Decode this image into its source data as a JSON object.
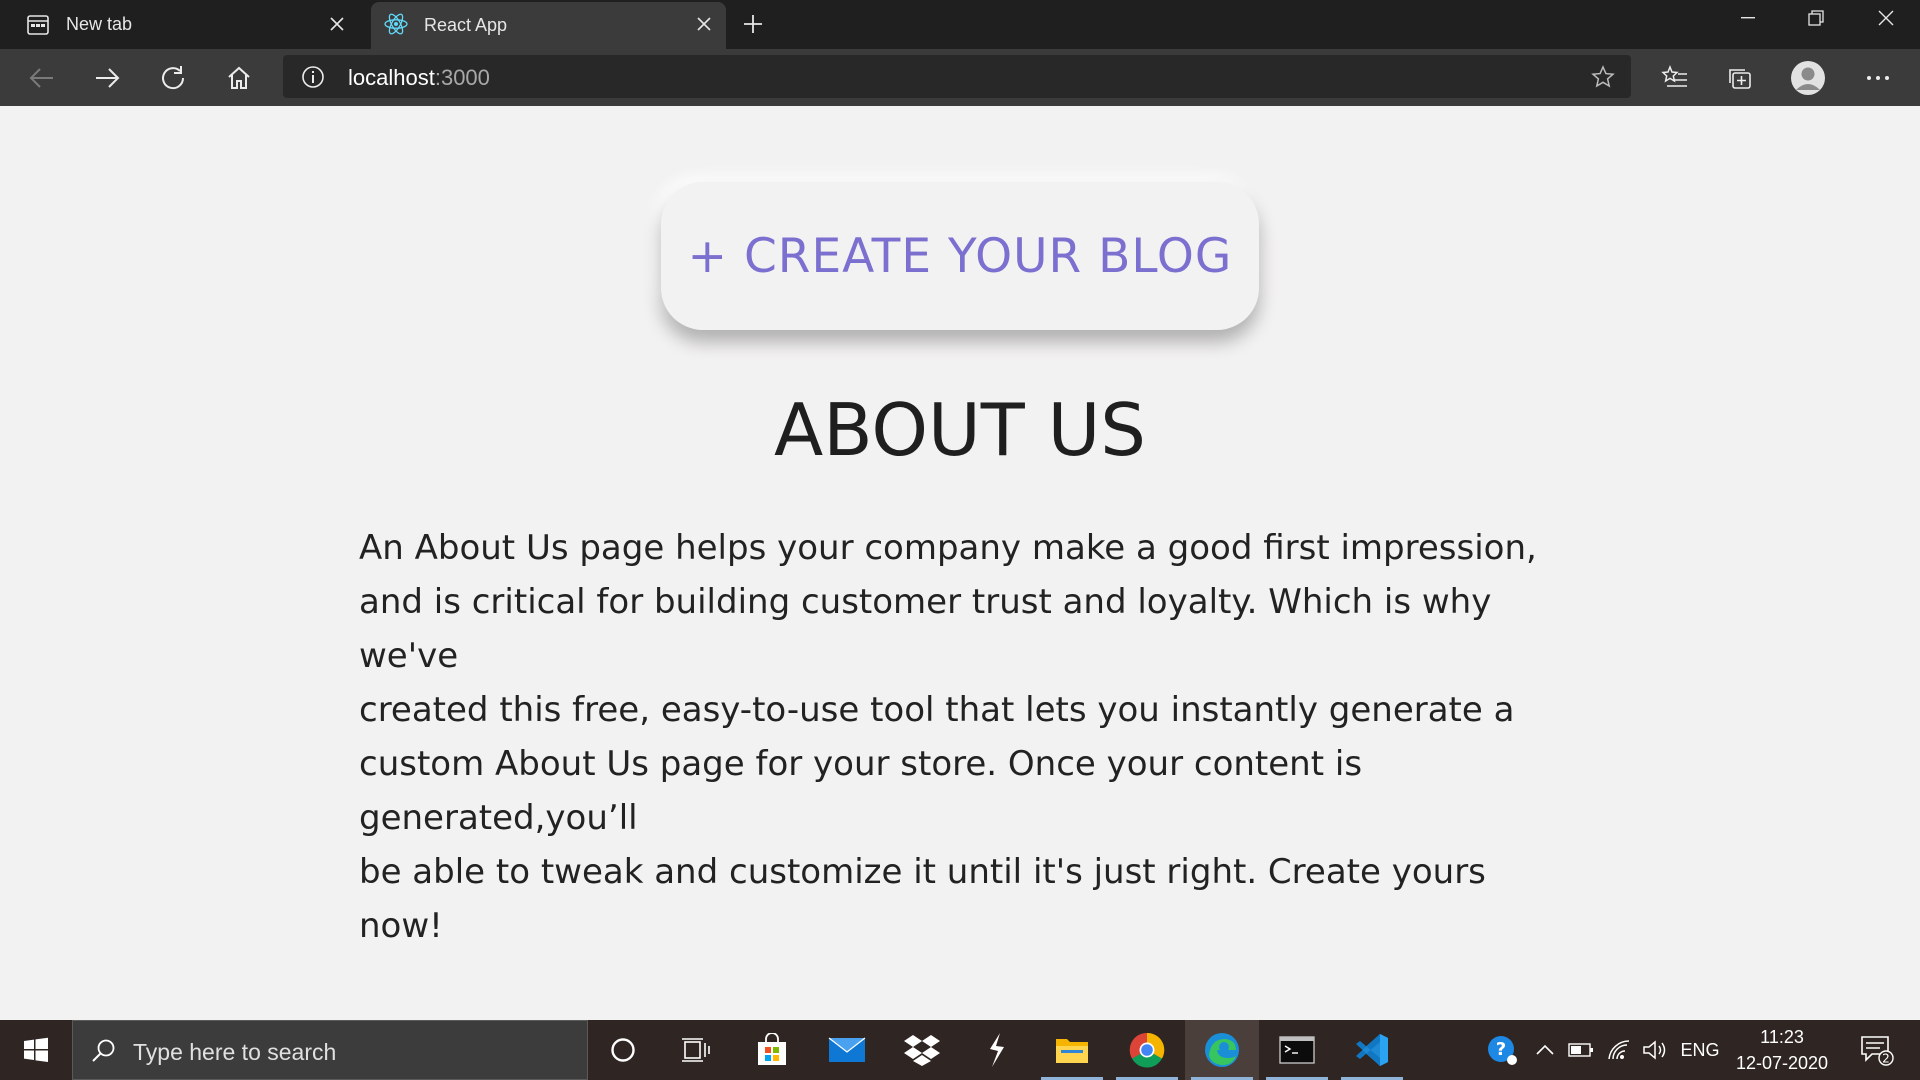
{
  "browser": {
    "tabs": [
      {
        "title": "New tab",
        "state": "inactive",
        "icon": "newtab-icon"
      },
      {
        "title": "React App",
        "state": "active",
        "icon": "react-icon"
      }
    ],
    "address": {
      "host": "localhost",
      "port": ":3000"
    }
  },
  "page": {
    "create_button": "+ CREATE YOUR BLOG",
    "heading": "ABOUT US",
    "body_lines": [
      "An About Us page helps your company make a good first impression,",
      "and is critical for building customer trust and loyalty. Which is why we've",
      "created this free, easy-to-use tool that lets you instantly generate a",
      "custom About Us page for your store. Once your content is generated,you’ll",
      "be able to tweak and customize it until it's just right. Create yours now!"
    ],
    "accent_color": "#7b6fd0"
  },
  "taskbar": {
    "search_placeholder": "Type here to search",
    "language": "ENG",
    "time": "11:23",
    "date": "12-07-2020",
    "notification_count": "2"
  }
}
